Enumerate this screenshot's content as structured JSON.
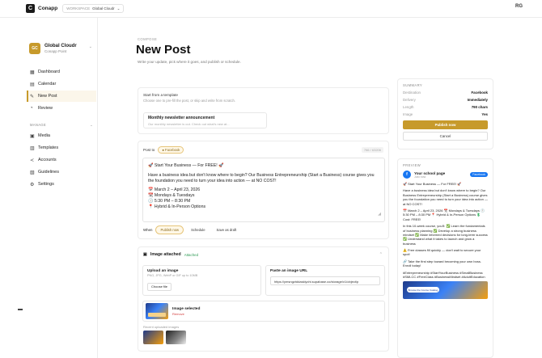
{
  "topbar": {
    "logo": "C",
    "brand": "Conapp",
    "workspace_label": "WORKSPACE",
    "workspace_value": "Global Cloudr",
    "user": "RG"
  },
  "account": {
    "initials": "GC",
    "name": "Global Cloudr",
    "sub": "Conapp Point"
  },
  "nav": [
    {
      "icon": "▦",
      "label": "Dashboard"
    },
    {
      "icon": "▤",
      "label": "Calendar"
    },
    {
      "icon": "✎",
      "label": "New Post"
    },
    {
      "icon": "◔",
      "label": "Review"
    }
  ],
  "manage": {
    "label": "MANAGE",
    "items": [
      {
        "icon": "▣",
        "label": "Media"
      },
      {
        "icon": "▥",
        "label": "Templates"
      },
      {
        "icon": "≺",
        "label": "Accounts"
      },
      {
        "icon": "▧",
        "label": "Guidelines"
      },
      {
        "icon": "⚙",
        "label": "Settings"
      }
    ]
  },
  "page": {
    "crumb": "COMPOSE",
    "title": "New Post",
    "subtitle": "Write your update, pick where it goes, and publish or schedule."
  },
  "template": {
    "label": "Start from a template",
    "hint": "Choose one to pre-fill the post, or skip and write from scratch.",
    "item_title": "Monthly newsletter announcement",
    "item_desc": "Our monthly newsletter is out. Check out what's new at..."
  },
  "post": {
    "post_to": "Post to",
    "platform": "Facebook",
    "count": "766 / 63206",
    "body": [
      "🚀 Start Your Business — For FREE! 🚀",
      "Have a business idea but don't know where to begin? Our Business Entrepreneurship (Start a Business) course gives you the foundation you need to turn your idea into action — at NO COST!",
      "📅 March 2 – April 23, 2026",
      "📆 Mondays & Tuesdays",
      "🕔 5:30 PM – 8:30 PM",
      "📍 Hybrid & In-Person Options"
    ],
    "when": "When",
    "opt_now": "Publish now",
    "opt_schedule": "Schedule",
    "opt_draft": "Save as draft"
  },
  "image": {
    "title": "Image attached",
    "status": "Attached",
    "upload_title": "Upload an image",
    "upload_hint": "PNG, JPG, WebP or GIF up to 10MB",
    "choose": "Choose file",
    "url_title": "Paste an image URL",
    "url_value": "https://ymsngztddasklychi.supabase.co/storage/v1/object/p",
    "selected": "Image selected",
    "remove": "Remove",
    "recent": "Recent uploaded images"
  },
  "summary": {
    "title": "SUMMARY",
    "rows": [
      {
        "k": "Destination",
        "v": "Facebook"
      },
      {
        "k": "Delivery",
        "v": "Immediately"
      },
      {
        "k": "Length",
        "v": "790 chars"
      },
      {
        "k": "Image",
        "v": "Yes"
      }
    ],
    "publish": "Publish now",
    "cancel": "Cancel"
  },
  "preview": {
    "title": "PREVIEW",
    "page_name": "Your school page",
    "page_sub": "Just now",
    "platform": "Facebook",
    "body": [
      "🚀 Start Your Business — For FREE! 🚀",
      "Have a business idea but don't know where to begin? Our Business Entrepreneurship (Start a Business) course gives you the foundation you need to turn your idea into action — at NO COST!",
      "📅 March 2 – April 23, 2026 📆 Mondays & Tuesdays 🕔 5:30 PM – 8:30 PM 📍 Hybrid & In-Person Options 💲 Cost: FREE!",
      "In this 10-week course, you'll: ✅ Learn the fundamentals of business planning ✅ Develop a strong business mindset ✅ Make informed decisions for long-term success ✅ Understand what it takes to launch and grow a business",
      "⚠️ Free classes fill quickly — don't wait to secure your spot!",
      "🔗 Take the first step toward becoming your own boss. Enroll today!",
      "#Entrepreneurship #StartYourBusiness #SmallBusiness #SMLCC #FreeClass #BusinessMindset #AdultEducation"
    ],
    "img_btn": "Browse the Course Catalog"
  }
}
